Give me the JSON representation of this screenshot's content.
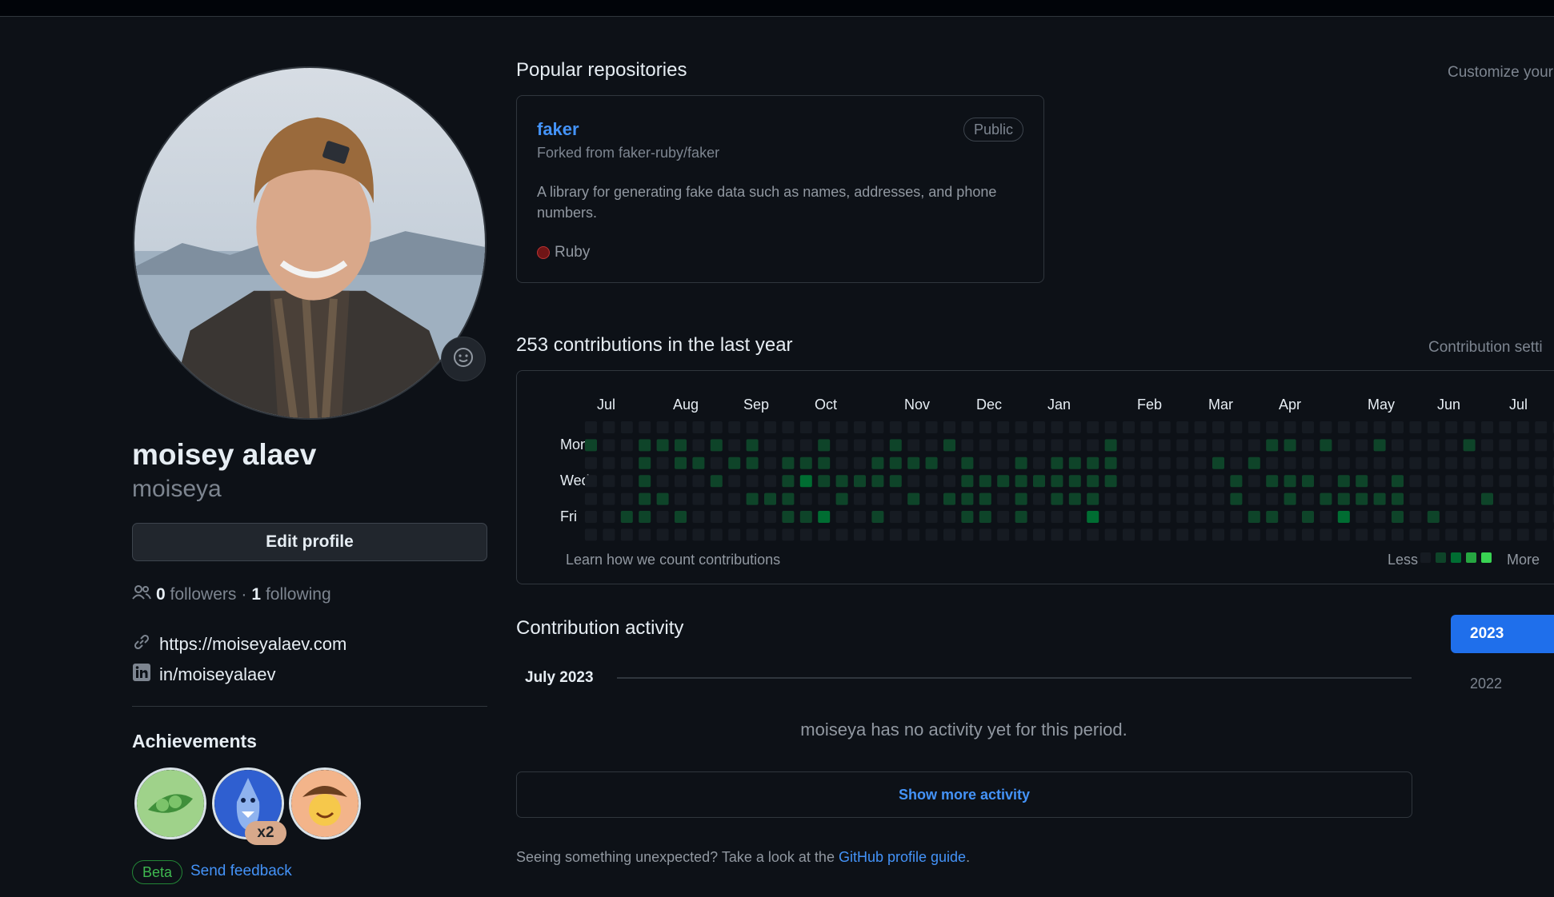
{
  "profile": {
    "name": "moisey alaev",
    "login": "moiseya",
    "edit_label": "Edit profile",
    "followers_count": "0",
    "followers_label": "followers",
    "separator": "·",
    "following_count": "1",
    "following_label": "following",
    "website": "https://moiseyalaev.com",
    "linkedin": "in/moiseyalaev",
    "icons": [
      "smiley-icon",
      "people-icon",
      "link-icon",
      "linkedin-icon"
    ]
  },
  "achievements": {
    "title": "Achievements",
    "badges": [
      "pair-extraordinaire",
      "shark",
      "yolo"
    ],
    "count_label": "x2",
    "beta_label": "Beta",
    "feedback_label": "Send feedback"
  },
  "repos": {
    "title": "Popular repositories",
    "customize_label": "Customize your",
    "items": [
      {
        "name": "faker",
        "visibility": "Public",
        "forked_from": "Forked from faker-ruby/faker",
        "description": "A library for generating fake data such as names, addresses, and phone numbers.",
        "language": "Ruby",
        "language_color": "#701516"
      }
    ]
  },
  "contributions": {
    "title": "253 contributions in the last year",
    "settings_label": "Contribution setti",
    "months": [
      "Jul",
      "Aug",
      "Sep",
      "Oct",
      "Nov",
      "Dec",
      "Jan",
      "Feb",
      "Mar",
      "Apr",
      "May",
      "Jun",
      "Jul"
    ],
    "days": [
      "Mon",
      "Wed",
      "Fri"
    ],
    "learn_label": "Learn how we count contributions",
    "less_label": "Less",
    "more_label": "More",
    "colors": [
      "#161b22",
      "#0e4429",
      "#006d32",
      "#26a641",
      "#39d353"
    ],
    "levels": [
      "0000000000000000000000000000000000000000000000000000000",
      "1001110101000100010010000000010000000011010010000100000",
      "0001011011011100111101001011110000010100000000000000000",
      "0001000100012111110001111111110000001011101101000000000",
      "0001100001110010001011101011100000001001011111000010000",
      "0011010000011200100001101000200000000110102001010000000",
      "0000000000000000000000000000000000000000000000000000000"
    ]
  },
  "activity": {
    "title": "Contribution activity",
    "years": [
      "2023",
      "2022"
    ],
    "period": "July 2023",
    "empty_message": "moiseya has no activity yet for this period.",
    "show_more_label": "Show more activity",
    "footer_text": "Seeing something unexpected? Take a look at the",
    "footer_link": "GitHub profile guide",
    "footer_end": "."
  }
}
